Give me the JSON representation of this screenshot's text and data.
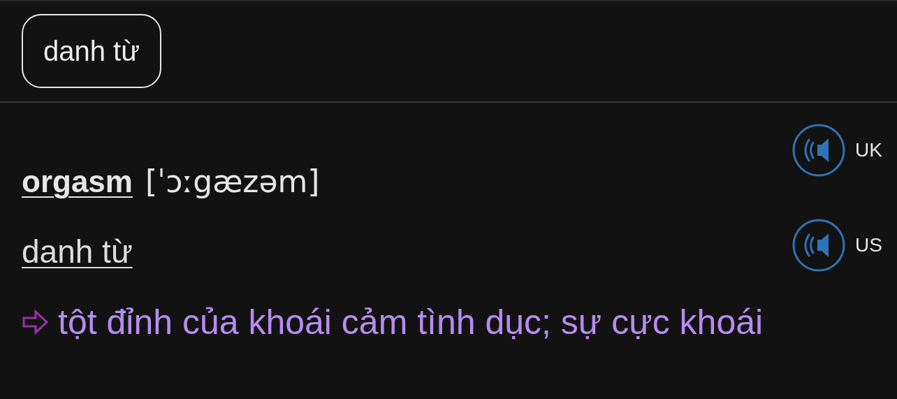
{
  "filter_chip": {
    "label": "danh từ"
  },
  "entry": {
    "headword": "orgasm",
    "pronunciation": "[ˈɔːgæzəm]",
    "part_of_speech": "danh từ",
    "definitions": [
      "tột đỉnh của khoái cảm tình dục; sự cực khoái"
    ],
    "audio": [
      {
        "label": "UK"
      },
      {
        "label": "US"
      }
    ]
  }
}
